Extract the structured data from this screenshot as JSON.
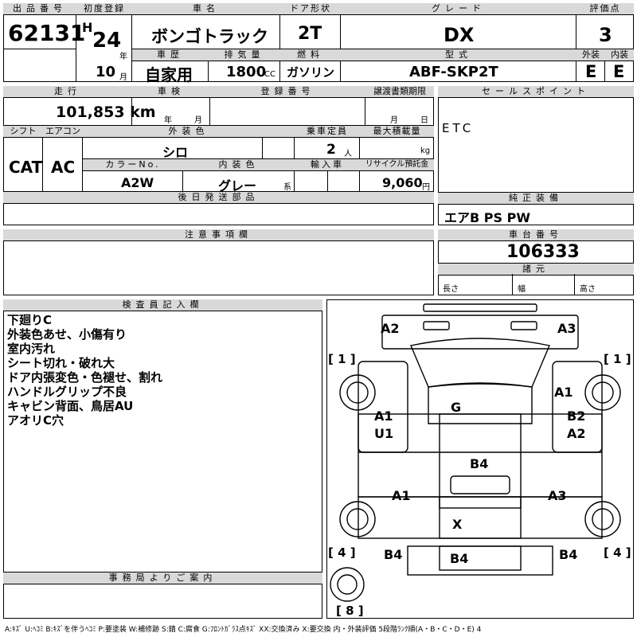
{
  "header": {
    "lot_label": "出品番号",
    "lot_value": "62131",
    "year_label": "初度登録",
    "era": "H",
    "year_value": "24",
    "year_unit": "年",
    "month_value": "10",
    "month_unit": "月",
    "car_name_label": "車名",
    "car_name": "ボンゴトラック",
    "doors_label": "ドア形状",
    "doors": "2T",
    "grade_label": "グレード",
    "grade": "DX",
    "score_label": "評価点",
    "score": "3",
    "history_label": "車歴",
    "history": "自家用",
    "displacement_label": "排気量",
    "displacement": "1800",
    "displacement_unit": "CC",
    "fuel_label": "燃料",
    "fuel": "ガソリン",
    "model_label": "型式",
    "model": "ABF-SKP2T",
    "ext_label": "外装",
    "ext": "E",
    "int_label": "内装",
    "int": "E"
  },
  "row2": {
    "mileage_label": "走行",
    "mileage": "101,853 km",
    "inspection_label": "車検",
    "insp_year_unit": "年",
    "insp_month_unit": "月",
    "regno_label": "登録番号",
    "transfer_label": "譲渡書類期限",
    "transfer_month_unit": "月",
    "transfer_day_unit": "日",
    "shift_label": "シフト",
    "shift": "CAT",
    "ac_label": "エアコン",
    "ac": "AC",
    "ext_color_label": "外装色",
    "ext_color": "シロ",
    "capacity_label": "乗車定員",
    "capacity": "2",
    "capacity_unit": "人",
    "load_label": "最大積載量",
    "load_unit": "kg",
    "color_no_label": "カラーNo.",
    "color_no": "A2W",
    "int_color_label": "内装色",
    "int_color": "グレー",
    "int_color_unit": "系",
    "import_label": "輸入車",
    "recycle_label": "リサイクル預託金",
    "recycle": "9,060",
    "recycle_unit": "円",
    "later_parts_label": "後日発送部品"
  },
  "sales": {
    "label": "セールスポイント",
    "text": "ETC",
    "equip_label": "純正装備",
    "equip": "エアB PS PW",
    "chassis_label": "車台番号",
    "chassis": "106333",
    "spec_label": "諸元",
    "length_label": "長さ",
    "width_label": "幅",
    "height_label": "高さ"
  },
  "notes": {
    "caution_label": "注意事項欄",
    "inspector_label": "検査員記入欄",
    "inspector_lines": "下廻りC\n外装色あせ、小傷有り\n室内汚れ\nシート切れ・破れ大\nドア内張変色・色褪せ、割れ\nハンドルグリップ不良\nキャビン背面、鳥居AU\nアオリC穴",
    "office_label": "事務局よりご案内"
  },
  "diagram": {
    "marks": {
      "a2_left": "A2",
      "a3_right": "A3",
      "g": "G",
      "a1_right_front": "A1",
      "a1_left": "A1",
      "u1_left": "U1",
      "b2_right": "B2",
      "a2_right": "A2",
      "b4_center": "B4",
      "a1_lower_left": "A1",
      "a3_lower_right": "A3",
      "x": "X",
      "b4_left": "B4",
      "b4_center_lower": "B4",
      "b4_right": "B4"
    },
    "brackets": {
      "left_top": "[ 1 ]",
      "right_top": "[ 1 ]",
      "left_bottom": "[ 4 ]",
      "right_bottom": "[ 4 ]",
      "spare": "[ 8 ]"
    }
  },
  "legend": "A:ｷｽﾞ U:ﾍｺﾐ B:ｷｽﾞを伴うﾍｺﾐ P:要塗装 W:補修跡 S:錆 C:腐食 G:ﾌﾛﾝﾄｶﾞﾗｽ点ｷｽﾞ XX:交換済み X:要交換 内・外装評価 5段階ﾗﾝｸ順(A・B・C・D・E) 4"
}
